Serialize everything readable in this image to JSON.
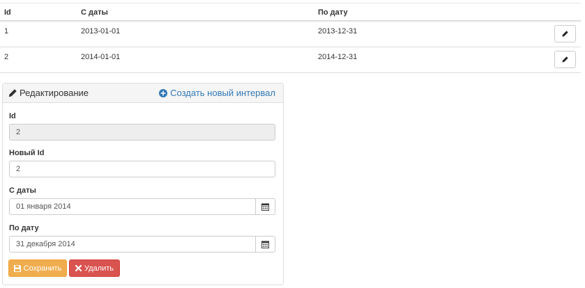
{
  "table": {
    "headers": {
      "id": "Id",
      "from": "С даты",
      "to": "По дату"
    },
    "rows": [
      {
        "id": "1",
        "from": "2013-01-01",
        "to": "2013-12-31"
      },
      {
        "id": "2",
        "from": "2014-01-01",
        "to": "2014-12-31"
      }
    ]
  },
  "panel": {
    "title": "Редактирование",
    "new_link": "Создать новый интервал",
    "fields": {
      "id_label": "Id",
      "id_value": "2",
      "new_id_label": "Новый Id",
      "new_id_value": "2",
      "from_label": "С даты",
      "from_value": "01 января 2014",
      "to_label": "По дату",
      "to_value": "31 декабря 2014"
    },
    "buttons": {
      "save": "Сохранить",
      "delete": "Удалить"
    }
  },
  "colors": {
    "link": "#337ab7",
    "save": "#f0ad4e",
    "delete": "#d9534f"
  },
  "icons": [
    "pencil-icon",
    "plus-circle-icon",
    "calendar-icon",
    "floppy-disk-icon",
    "remove-icon"
  ]
}
